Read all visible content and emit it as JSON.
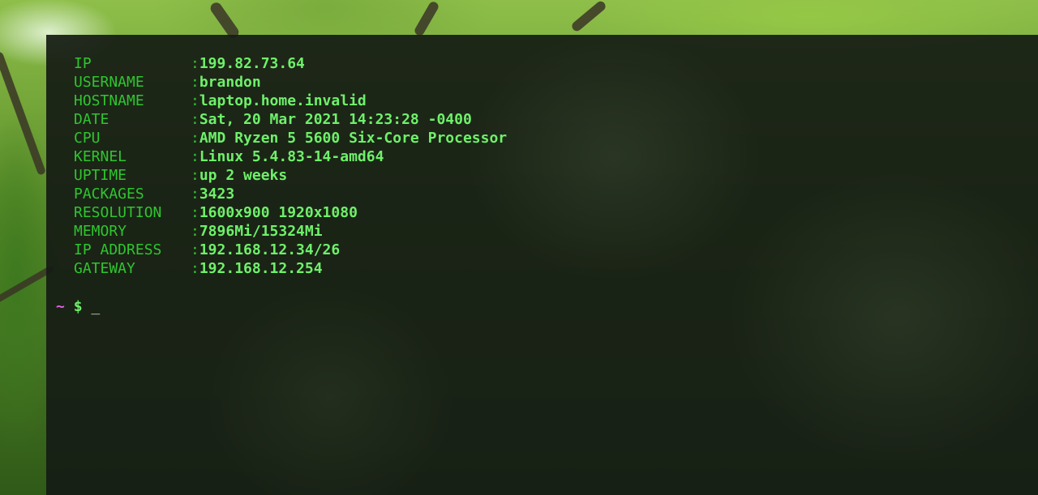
{
  "system_info": [
    {
      "key": "IP",
      "value": "199.82.73.64"
    },
    {
      "key": "USERNAME",
      "value": "brandon"
    },
    {
      "key": "HOSTNAME",
      "value": "laptop.home.invalid"
    },
    {
      "key": "DATE",
      "value": "Sat, 20 Mar 2021 14:23:28 -0400"
    },
    {
      "key": "CPU",
      "value": "AMD Ryzen 5 5600 Six-Core Processor"
    },
    {
      "key": "KERNEL",
      "value": "Linux 5.4.83-14-amd64"
    },
    {
      "key": "UPTIME",
      "value": "up 2 weeks"
    },
    {
      "key": "PACKAGES",
      "value": "3423"
    },
    {
      "key": "RESOLUTION",
      "value": "1600x900 1920x1080"
    },
    {
      "key": "MEMORY",
      "value": "7896Mi/15324Mi"
    },
    {
      "key": "IP ADDRESS",
      "value": "192.168.12.34/26"
    },
    {
      "key": "GATEWAY",
      "value": "192.168.12.254"
    }
  ],
  "separator": ":",
  "prompt": {
    "cwd": "~",
    "symbol": "$",
    "cursor": "_"
  },
  "colors": {
    "key": "#2fc52f",
    "value": "#6ff06a",
    "cwd": "#e060e0",
    "terminal_bg": "#161c14"
  }
}
